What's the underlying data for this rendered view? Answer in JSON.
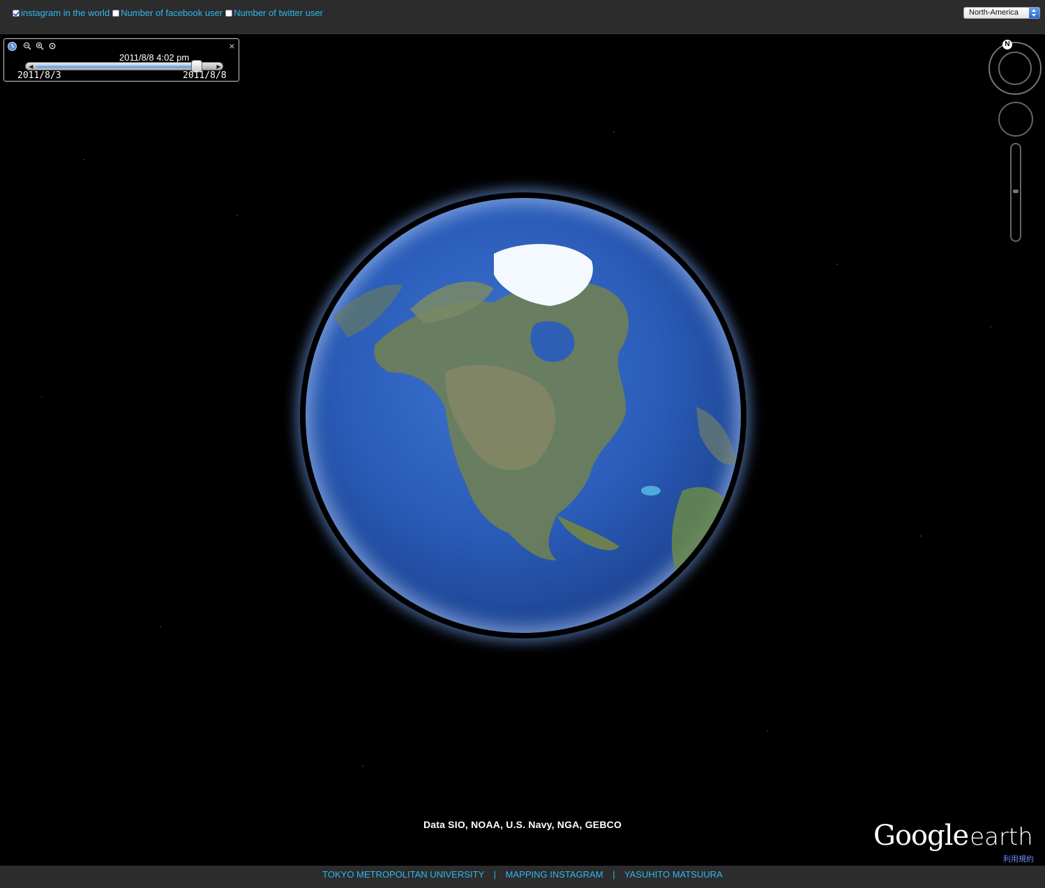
{
  "layers": [
    {
      "label": "instagram in the world",
      "checked": true
    },
    {
      "label": "Number of facebook user",
      "checked": false
    },
    {
      "label": "Number of twitter user",
      "checked": false
    }
  ],
  "region_select": {
    "value": "North-America"
  },
  "timeline": {
    "current": "2011/8/8   4:02 pm",
    "start": "2011/8/3",
    "end": "2011/8/8",
    "position": 0.93,
    "close_glyph": "×"
  },
  "nav": {
    "north_label": "N"
  },
  "attribution": "Data SIO, NOAA, U.S. Navy, NGA, GEBCO",
  "logo": {
    "google": "Google",
    "earth": "earth",
    "terms": "利用規約"
  },
  "footer": {
    "links": [
      "TOKYO METROPOLITAN UNIVERSITY",
      "MAPPING INSTAGRAM",
      "YASUHITO MATSUURA"
    ],
    "separator": "|"
  }
}
